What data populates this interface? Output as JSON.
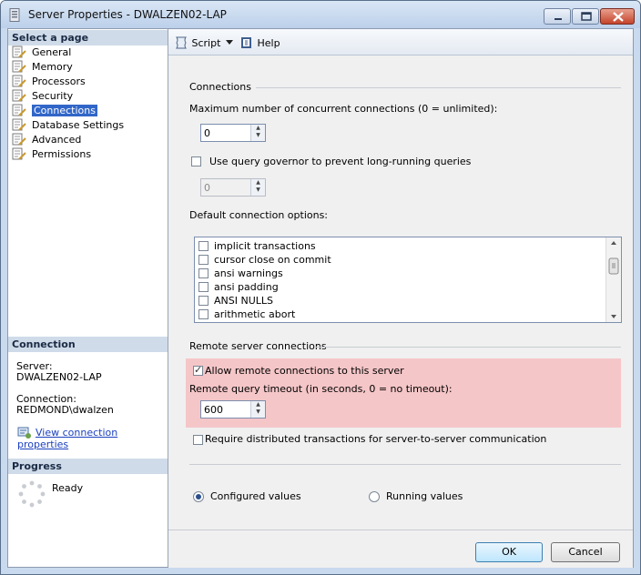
{
  "window": {
    "title": "Server Properties - DWALZEN02-LAP"
  },
  "left": {
    "select_header": "Select a page",
    "pages": [
      {
        "label": "General"
      },
      {
        "label": "Memory"
      },
      {
        "label": "Processors"
      },
      {
        "label": "Security"
      },
      {
        "label": "Connections",
        "selected": true
      },
      {
        "label": "Database Settings"
      },
      {
        "label": "Advanced"
      },
      {
        "label": "Permissions"
      }
    ],
    "connection_header": "Connection",
    "server_label": "Server:",
    "server_value": "DWALZEN02-LAP",
    "connection_label": "Connection:",
    "connection_value": "REDMOND\\dwalzen",
    "view_link": "View connection properties",
    "progress_header": "Progress",
    "progress_status": "Ready"
  },
  "toolbar": {
    "script_label": "Script",
    "help_label": "Help"
  },
  "connections": {
    "group_label": "Connections",
    "max_label": "Maximum number of concurrent connections (0 = unlimited):",
    "max_value": "0",
    "governor_label": "Use query governor to prevent long-running queries",
    "governor_checked": false,
    "governor_value": "0",
    "default_options_label": "Default connection options:",
    "options": [
      {
        "label": "implicit transactions",
        "checked": false
      },
      {
        "label": "cursor close on commit",
        "checked": false
      },
      {
        "label": "ansi warnings",
        "checked": false
      },
      {
        "label": "ansi padding",
        "checked": false
      },
      {
        "label": "ANSI NULLS",
        "checked": false
      },
      {
        "label": "arithmetic abort",
        "checked": false
      }
    ]
  },
  "remote": {
    "group_label": "Remote server connections",
    "allow_label": "Allow remote connections to this server",
    "allow_checked": true,
    "timeout_label": "Remote query timeout (in seconds, 0 = no timeout):",
    "timeout_value": "600",
    "distributed_label": "Require distributed transactions for server-to-server communication",
    "distributed_checked": false
  },
  "values": {
    "configured_label": "Configured values",
    "running_label": "Running values",
    "selected": "configured"
  },
  "buttons": {
    "ok": "OK",
    "cancel": "Cancel"
  },
  "colors": {
    "highlight": "#f5c6c8",
    "selection": "#3166c8",
    "link": "#1a3fbf"
  }
}
